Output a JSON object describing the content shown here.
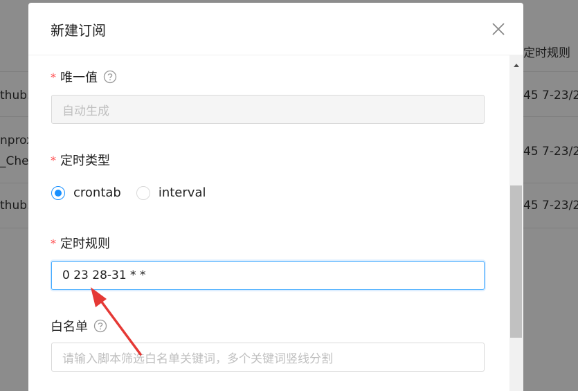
{
  "background": {
    "header_cell": "定时规则",
    "rows": [
      {
        "left": "thub.",
        "right": "45 7-23/2"
      },
      {
        "left": "nprox",
        "left2": "_Che",
        "right": "45 7-23/2"
      },
      {
        "left": "thub.",
        "right": "45 7-23/2"
      }
    ]
  },
  "modal": {
    "title": "新建订阅",
    "fields": {
      "unique": {
        "required": "*",
        "label": "唯一值",
        "value": "自动生成"
      },
      "schedule_type": {
        "required": "*",
        "label": "定时类型",
        "options": [
          {
            "label": "crontab",
            "checked": true
          },
          {
            "label": "interval",
            "checked": false
          }
        ]
      },
      "schedule_rule": {
        "required": "*",
        "label": "定时规则",
        "value": "0 23 28-31 * *"
      },
      "whitelist": {
        "label": "白名单",
        "placeholder": "请输入脚本筛选白名单关键词，多个关键词竖线分割"
      }
    }
  },
  "colors": {
    "accent": "#1890ff",
    "required": "#ff4d4f",
    "annotation_arrow": "#e53935"
  }
}
